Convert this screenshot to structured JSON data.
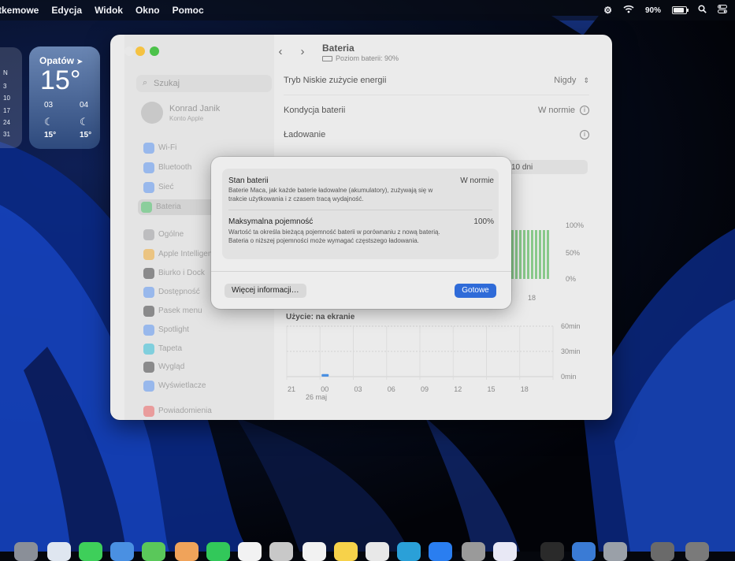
{
  "menubar": {
    "items": [
      "tkemowe",
      "Edycja",
      "Widok",
      "Okno",
      "Pomoc"
    ],
    "battery_percent": "90%",
    "battery_level": 0.9
  },
  "widgets": {
    "calendar_column": [
      "N",
      "3",
      "10",
      "17",
      "24",
      "31"
    ],
    "weather": {
      "city": "Opatów",
      "temperature": "15°",
      "forecast": [
        {
          "hour": "03",
          "temp": "15°"
        },
        {
          "hour": "04",
          "temp": "15°"
        }
      ]
    }
  },
  "window": {
    "search_placeholder": "Szukaj",
    "account": {
      "name": "Konrad Janik",
      "subtitle": "Konto Apple"
    },
    "sidebar": [
      {
        "label": "Wi-Fi",
        "icon": "wifi-icon",
        "color": "#3b82f6"
      },
      {
        "label": "Bluetooth",
        "icon": "bluetooth-icon",
        "color": "#3b82f6"
      },
      {
        "label": "Sieć",
        "icon": "globe-icon",
        "color": "#3b82f6"
      },
      {
        "label": "Bateria",
        "icon": "battery-icon",
        "color": "#34c759",
        "selected": true
      },
      {
        "label": "Ogólne",
        "icon": "gear-icon",
        "color": "#8e8e93"
      },
      {
        "label": "Apple Intelligence",
        "icon": "sparkle-icon",
        "color": "#f59e0b"
      },
      {
        "label": "Biurko i Dock",
        "icon": "dock-icon",
        "color": "#1c1c1e"
      },
      {
        "label": "Dostępność",
        "icon": "accessibility-icon",
        "color": "#3b82f6"
      },
      {
        "label": "Pasek menu",
        "icon": "menubar-icon",
        "color": "#1c1c1e"
      },
      {
        "label": "Spotlight",
        "icon": "spotlight-icon",
        "color": "#3b82f6"
      },
      {
        "label": "Tapeta",
        "icon": "wallpaper-icon",
        "color": "#06b6d4"
      },
      {
        "label": "Wygląd",
        "icon": "appearance-icon",
        "color": "#1c1c1e"
      },
      {
        "label": "Wyświetlacze",
        "icon": "display-icon",
        "color": "#3b82f6"
      },
      {
        "label": "Powiadomienia",
        "icon": "bell-icon",
        "color": "#ef4444"
      }
    ],
    "toolbar": {
      "title": "Bateria",
      "subtitle": "Poziom baterii: 90%"
    },
    "rows": {
      "low_power_label": "Tryb Niskie zużycie energii",
      "low_power_value": "Nigdy",
      "health_label": "Kondycja baterii",
      "health_value": "W normie",
      "charging_label": "Ładowanie"
    },
    "segment_partial": "10 dni",
    "chart_top": {
      "y_ticks": [
        "100%",
        "50%",
        "0%"
      ],
      "x_tick": "18"
    },
    "chart_bottom": {
      "title": "Użycie: na ekranie",
      "y_ticks": [
        "60min",
        "30min",
        "0min"
      ],
      "x_ticks": [
        "21",
        "00",
        "03",
        "06",
        "09",
        "12",
        "15",
        "18"
      ],
      "date_label": "26 maj"
    }
  },
  "chart_data": {
    "type": "bar",
    "title": "Użycie: na ekranie",
    "categories": [
      "21",
      "00",
      "03",
      "06",
      "09",
      "12",
      "15",
      "18"
    ],
    "values": [
      0,
      3,
      0,
      0,
      0,
      0,
      0,
      0
    ],
    "ylabel": "",
    "ylim": [
      0,
      60
    ],
    "y_ticks": [
      "60min",
      "30min",
      "0min"
    ],
    "grid": true
  },
  "dialog": {
    "section1_title": "Stan baterii",
    "section1_value": "W normie",
    "section1_desc": "Baterie Maca, jak każde baterie ładowalne (akumulatory), zużywają się w trakcie użytkowania i z czasem tracą wydajność.",
    "section2_title": "Maksymalna pojemność",
    "section2_value": "100%",
    "section2_desc": "Wartość ta określa bieżącą pojemność baterii w porównaniu z nową baterią. Bateria o niższej pojemności może wymagać częstszego ładowania.",
    "more_button": "Więcej informacji…",
    "done_button": "Gotowe"
  }
}
